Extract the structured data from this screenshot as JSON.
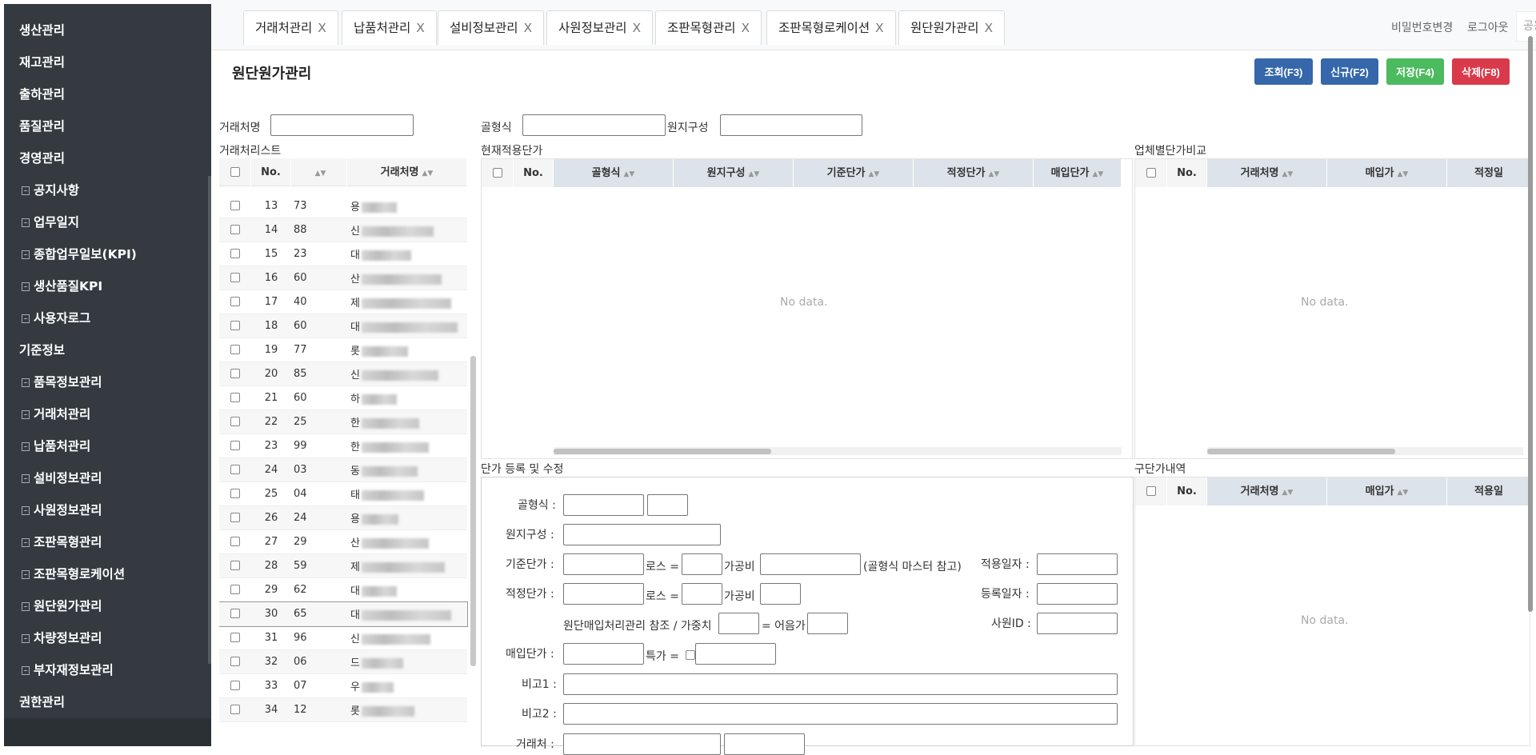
{
  "sidebar": {
    "items": [
      {
        "label": "생산관리",
        "sub": false
      },
      {
        "label": "재고관리",
        "sub": false
      },
      {
        "label": "출하관리",
        "sub": false
      },
      {
        "label": "품질관리",
        "sub": false
      },
      {
        "label": "경영관리",
        "sub": false
      },
      {
        "label": "공지사항",
        "sub": true
      },
      {
        "label": "업무일지",
        "sub": true
      },
      {
        "label": "종합업무일보(KPI)",
        "sub": true
      },
      {
        "label": "생산품질KPI",
        "sub": true
      },
      {
        "label": "사용자로그",
        "sub": true
      },
      {
        "label": "기준정보",
        "sub": false
      },
      {
        "label": "품목정보관리",
        "sub": true
      },
      {
        "label": "거래처관리",
        "sub": true
      },
      {
        "label": "납품처관리",
        "sub": true
      },
      {
        "label": "설비정보관리",
        "sub": true
      },
      {
        "label": "사원정보관리",
        "sub": true
      },
      {
        "label": "조판목형관리",
        "sub": true
      },
      {
        "label": "조판목형로케이션",
        "sub": true
      },
      {
        "label": "원단원가관리",
        "sub": true
      },
      {
        "label": "차량정보관리",
        "sub": true
      },
      {
        "label": "부자재정보관리",
        "sub": true
      },
      {
        "label": "권한관리",
        "sub": false
      }
    ]
  },
  "tabs": [
    {
      "label": "거래처관리",
      "close": "X"
    },
    {
      "label": "납품처관리",
      "close": "X"
    },
    {
      "label": "설비정보관리",
      "close": "X"
    },
    {
      "label": "사원정보관리",
      "close": "X"
    },
    {
      "label": "조판목형관리",
      "close": "X"
    },
    {
      "label": "조판목형로케이션",
      "close": "X"
    },
    {
      "label": "원단원가관리",
      "close": "X"
    }
  ],
  "header": {
    "user_placeholder": "공용",
    "change_password": "비밀번호변경",
    "logout": "로그아웃"
  },
  "page": {
    "title": "원단원가관리",
    "buttons": {
      "search": "조회(F3)",
      "new": "신규(F2)",
      "save": "저장(F4)",
      "delete": "삭제(F8)"
    }
  },
  "filters": {
    "client_name_label": "거래처명",
    "flute_label": "골형식",
    "paper_label": "원지구성"
  },
  "client_list": {
    "title": "거래처리스트",
    "headers": {
      "no": "No.",
      "name": "거래처명"
    },
    "rows": [
      {
        "no": "13",
        "code": "73",
        "name": "용"
      },
      {
        "no": "14",
        "code": "88",
        "name": "신"
      },
      {
        "no": "15",
        "code": "23",
        "name": "대"
      },
      {
        "no": "16",
        "code": "60",
        "name": "산"
      },
      {
        "no": "17",
        "code": "40",
        "name": "제"
      },
      {
        "no": "18",
        "code": "60",
        "name": "대"
      },
      {
        "no": "19",
        "code": "77",
        "name": "롯"
      },
      {
        "no": "20",
        "code": "85",
        "name": "신"
      },
      {
        "no": "21",
        "code": "60",
        "name": "하"
      },
      {
        "no": "22",
        "code": "25",
        "name": "한"
      },
      {
        "no": "23",
        "code": "99",
        "name": "한"
      },
      {
        "no": "24",
        "code": "03",
        "name": "동"
      },
      {
        "no": "25",
        "code": "04",
        "name": "태"
      },
      {
        "no": "26",
        "code": "24",
        "name": "용"
      },
      {
        "no": "27",
        "code": "29",
        "name": "산"
      },
      {
        "no": "28",
        "code": "59",
        "name": "제"
      },
      {
        "no": "29",
        "code": "62",
        "name": "대"
      },
      {
        "no": "30",
        "code": "65",
        "name": "대"
      },
      {
        "no": "31",
        "code": "96",
        "name": "신"
      },
      {
        "no": "32",
        "code": "06",
        "name": "드"
      },
      {
        "no": "33",
        "code": "07",
        "name": "우"
      },
      {
        "no": "34",
        "code": "12",
        "name": "롯"
      }
    ]
  },
  "current_price": {
    "title": "현재적용단가",
    "headers": {
      "no": "No.",
      "flute": "골형식",
      "paper": "원지구성",
      "base": "기준단가",
      "proper": "적정단가",
      "purchase": "매입단가"
    },
    "empty": "No data."
  },
  "vendor_compare": {
    "title": "업체별단가비교",
    "headers": {
      "no": "No.",
      "name": "거래처명",
      "purchase": "매입가",
      "proper": "적정일"
    },
    "empty": "No data."
  },
  "old_price": {
    "title": "구단가내역",
    "headers": {
      "no": "No.",
      "name": "거래처명",
      "purchase": "매입가",
      "apply": "적용일"
    },
    "empty": "No data."
  },
  "form": {
    "title": "단가 등록 및 수정",
    "flute": "골형식 :",
    "paper": "원지구성 :",
    "base_price": "기준단가 :",
    "loss": "로스 =",
    "processing": "가공비",
    "flute_master_ref": "(골형식 마스터 참고)",
    "apply_date": "적용일자 :",
    "proper_price": "적정단가 :",
    "reg_date": "등록일자 :",
    "ref_text": "원단매입처리관리 참조 / 가중치",
    "eq_text": "= 어음가",
    "emp_id": "사원ID :",
    "purchase_price": "매입단가 :",
    "special": "특가 =",
    "note1": "비고1 :",
    "note2": "비고2 :",
    "client": "거래처 :"
  }
}
